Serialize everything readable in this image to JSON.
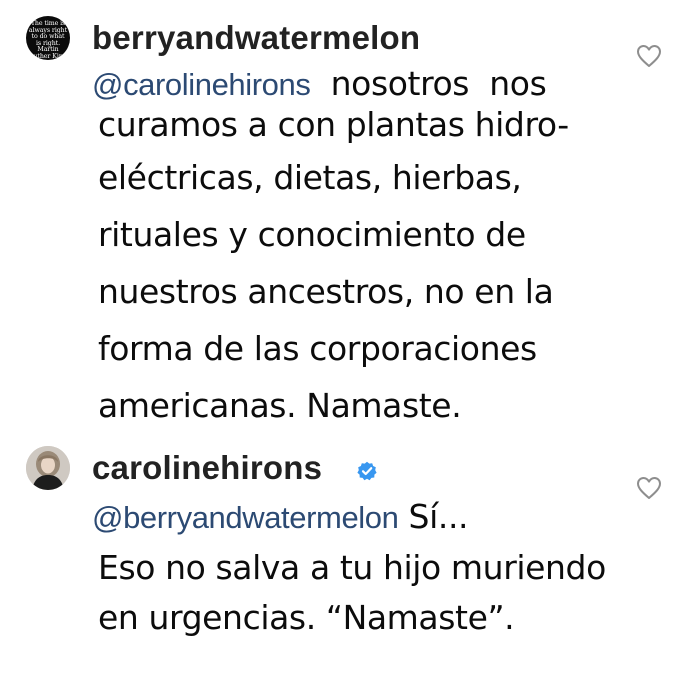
{
  "comments": [
    {
      "avatar_text": "The time is\nalways right\nto do what\nis right.\nMartin Luther King Jr.",
      "username": "berryandwatermelon",
      "verified": false,
      "mention": "@carolinehirons",
      "first_line_text": "  nosotros  nos",
      "lines": [
        "curamos a con plantas hidro-",
        "eléctricas, dietas, hierbas,",
        "rituales y conocimiento de",
        "nuestros ancestros, no en la",
        "forma de las corporaciones",
        "americanas. Namaste."
      ],
      "like_icon": "heart-outline-icon"
    },
    {
      "username": "carolinehirons",
      "verified": true,
      "verified_icon": "verified-badge-icon",
      "mention": "@berryandwatermelon",
      "first_line_text": " Sí...",
      "lines": [
        "Eso no salva a tu hijo muriendo",
        "en urgencias. “Namaste”."
      ],
      "like_icon": "heart-outline-icon"
    }
  ],
  "colors": {
    "mention": "#2c4a73",
    "username": "#222222",
    "text": "#0c0c0c",
    "verified": "#3897f0",
    "heart_stroke": "#8e8e8e"
  }
}
